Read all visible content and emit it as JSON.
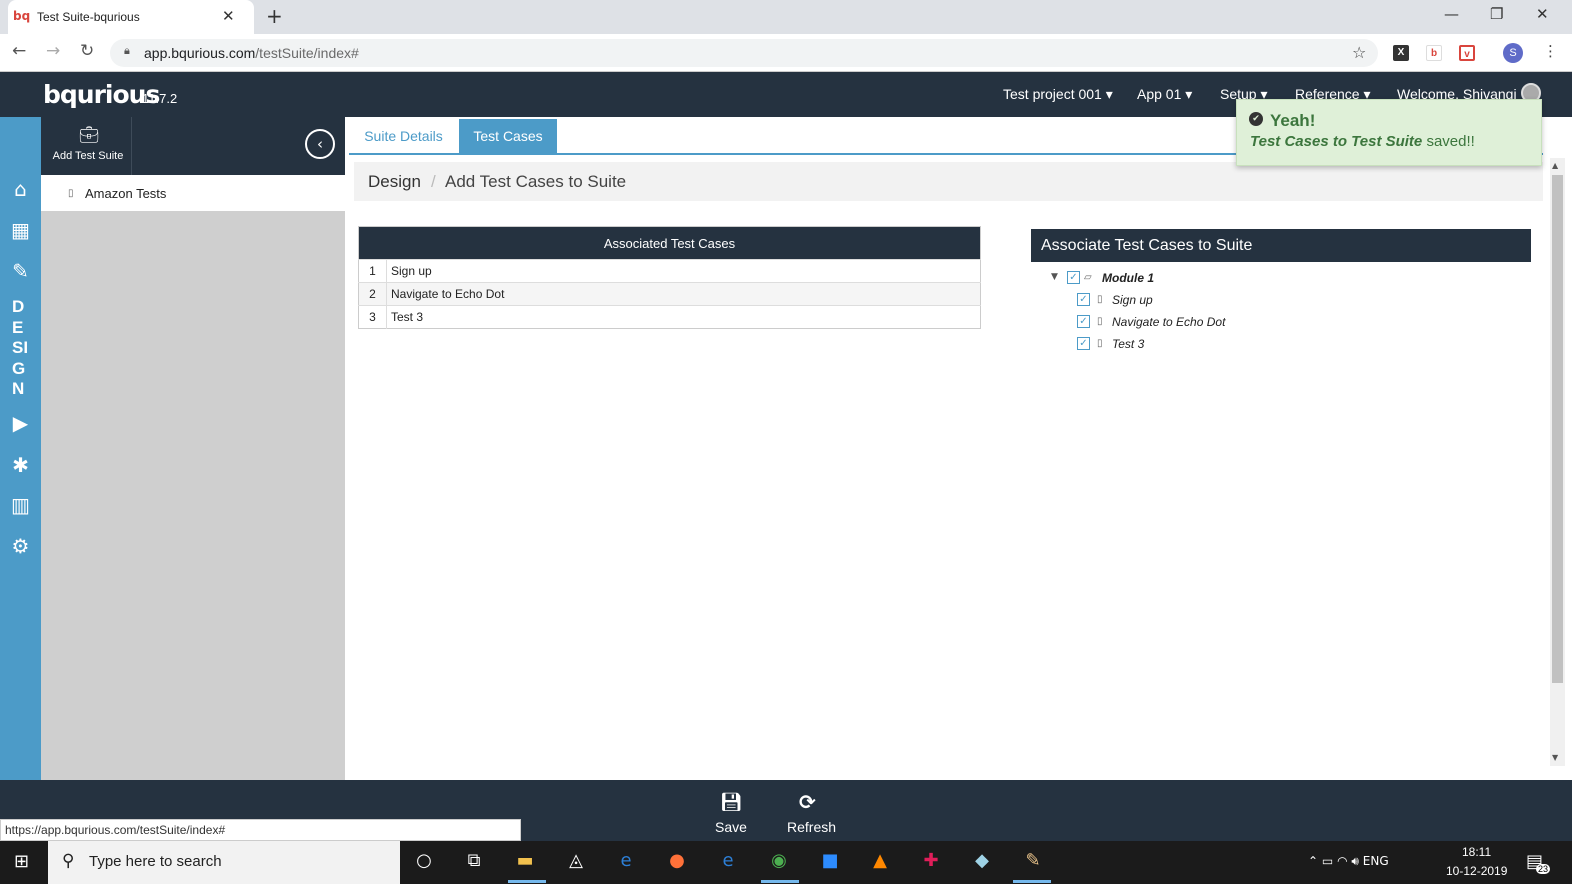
{
  "browser": {
    "tab_favicon": "bq",
    "tab_title": "Test Suite-bqurious",
    "tab_close": "✕",
    "new_tab": "+",
    "url_host": "app.bqurious.com",
    "url_path": "/testSuite/index#",
    "profile_initial": "S",
    "status_url": "https://app.bqurious.com/testSuite/index#"
  },
  "app": {
    "logo": "bqurious",
    "version": "11.7.2",
    "menu": {
      "project": "Test project 001",
      "app": "App 01",
      "setup": "Setup",
      "reference": "Reference",
      "welcome": "Welcome, Shivangi"
    },
    "rail": {
      "design_label": [
        "D",
        "E",
        "SI",
        "G",
        "N"
      ],
      "icons": [
        "home-icon",
        "calendar-icon",
        "pencil-icon",
        "play-icon",
        "bug-icon",
        "bar-chart-icon",
        "cogs-icon"
      ]
    },
    "sidebar": {
      "add_label": "Add Test Suite",
      "suites": [
        "Amazon Tests"
      ]
    },
    "tabs": [
      "Suite Details",
      "Test Cases"
    ],
    "breadcrumb": {
      "root": "Design",
      "separator": "/",
      "current": "Add Test Cases to Suite"
    },
    "associated": {
      "title": "Associated Test Cases",
      "rows": [
        {
          "num": "1",
          "name": "Sign up"
        },
        {
          "num": "2",
          "name": "Navigate to Echo Dot"
        },
        {
          "num": "3",
          "name": "Test 3"
        }
      ]
    },
    "associate_tree": {
      "title": "Associate Test Cases to Suite",
      "module": "Module 1",
      "items": [
        "Sign up",
        "Navigate to Echo Dot",
        "Test 3"
      ]
    },
    "toast": {
      "title": "Yeah!",
      "message_emphasis": "Test Cases to Test Suite",
      "message_rest": " saved!!"
    },
    "footer": {
      "save_label": "Save",
      "refresh_label": "Refresh"
    }
  },
  "taskbar": {
    "search_placeholder": "Type here to search",
    "tray_language": "ENG",
    "time": "18:11",
    "date": "10-12-2019",
    "notification_count": "23"
  },
  "colors": {
    "accent": "#4c9bc8",
    "header": "#253240",
    "toast_bg": "#dff0d8",
    "toast_text": "#3c763d"
  }
}
